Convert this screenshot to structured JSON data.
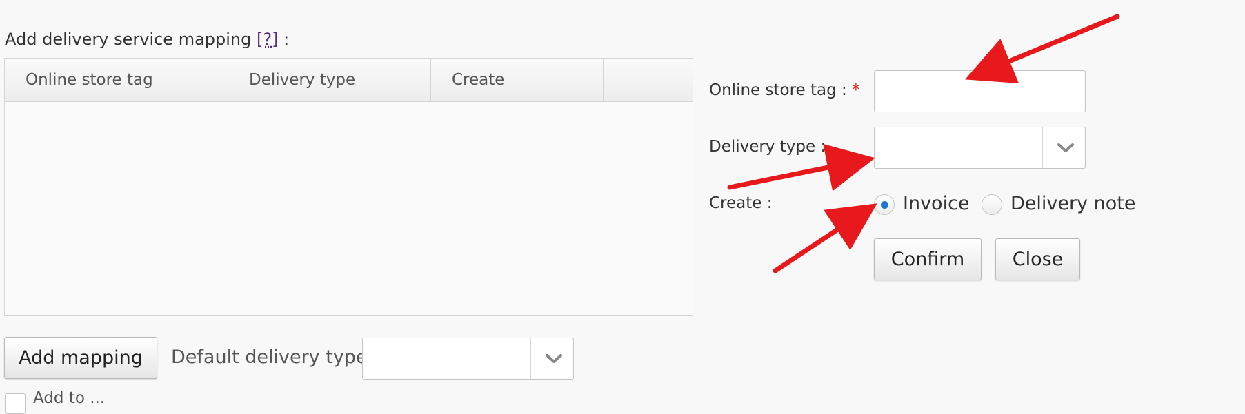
{
  "section": {
    "title": "Add delivery service mapping",
    "help_link": "[?]",
    "colon": ":"
  },
  "table": {
    "columns": [
      "Online store tag",
      "Delivery type",
      "Create",
      ""
    ],
    "rows": []
  },
  "form": {
    "online_store_tag": {
      "label": "Online store tag :",
      "required_marker": "*",
      "value": ""
    },
    "delivery_type": {
      "label": "Delivery type :",
      "value": ""
    },
    "create": {
      "label": "Create :",
      "options": [
        {
          "label": "Invoice",
          "selected": true
        },
        {
          "label": "Delivery note",
          "selected": false
        }
      ]
    },
    "confirm_label": "Confirm",
    "close_label": "Close"
  },
  "footer": {
    "add_mapping_label": "Add mapping",
    "default_delivery_type_label": "Default delivery type :",
    "default_delivery_type_value": "",
    "partial_checkbox_text": "Add to ..."
  },
  "colors": {
    "annotation_arrow": "#e8191c",
    "radio_selected": "#1e74d6",
    "required": "#e0221c",
    "help_link": "#5a2a82"
  },
  "icons": [
    "chevron-down-icon",
    "arrow-annotation"
  ]
}
